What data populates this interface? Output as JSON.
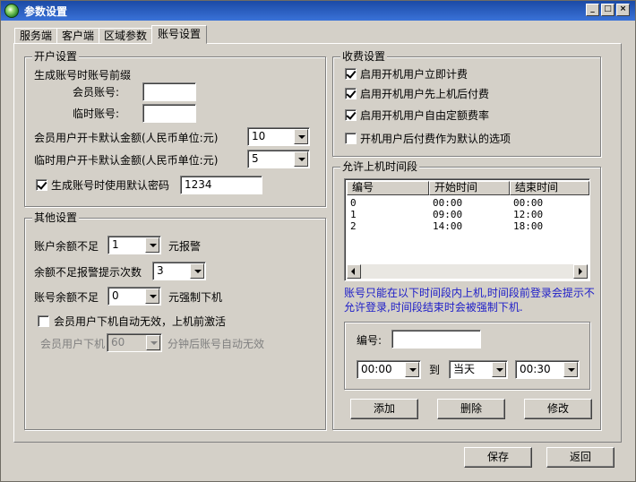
{
  "window": {
    "title": "参数设置",
    "min_glyph": "_",
    "max_glyph": "□",
    "close_glyph": "×"
  },
  "tabs": [
    {
      "label": "服务端"
    },
    {
      "label": "客户端"
    },
    {
      "label": "区域参数"
    },
    {
      "label": "账号设置"
    }
  ],
  "open_account": {
    "title": "开户设置",
    "prefix_heading": "生成账号时账号前缀",
    "member_account_label": "会员账号:",
    "member_account_value": "",
    "temp_account_label": "临时账号:",
    "temp_account_value": "",
    "member_default_amount_label": "会员用户开卡默认金额(人民币单位:元)",
    "member_default_amount_value": "10",
    "temp_default_amount_label": "临时用户开卡默认金额(人民币单位:元)",
    "temp_default_amount_value": "5",
    "default_password_label": "生成账号时使用默认密码",
    "default_password_checked": true,
    "default_password_value": "1234"
  },
  "other": {
    "title": "其他设置",
    "low_balance_label": "账户余额不足",
    "low_balance_value": "1",
    "low_balance_suffix": "元报警",
    "alert_count_label": "余额不足报警提示次数",
    "alert_count_value": "3",
    "force_offline_label": "账号余额不足",
    "force_offline_value": "0",
    "force_offline_suffix": "元强制下机",
    "auto_invalid_label": "会员用户下机自动无效，上机前激活",
    "auto_invalid_checked": false,
    "offline_label": "会员用户下机",
    "offline_value": "60",
    "offline_suffix": "分钟后账号自动无效"
  },
  "billing": {
    "title": "收费设置",
    "options": [
      {
        "label": "启用开机用户立即计费",
        "checked": true
      },
      {
        "label": "启用开机用户先上机后付费",
        "checked": true
      },
      {
        "label": "启用开机用户自由定额费率",
        "checked": true
      },
      {
        "label": "开机用户后付费作为默认的选项",
        "checked": false
      }
    ]
  },
  "time_slots": {
    "title": "允许上机时间段",
    "columns": [
      "编号",
      "开始时间",
      "结束时间"
    ],
    "rows": [
      [
        "0",
        "00:00",
        "00:00"
      ],
      [
        "1",
        "09:00",
        "12:00"
      ],
      [
        "2",
        "14:00",
        "18:00"
      ]
    ],
    "note": "账号只能在以下时间段内上机,时间段前登录会提示不允许登录,时间段结束时会被强制下机.",
    "id_label": "编号:",
    "id_value": "",
    "start_value": "00:00",
    "to_label": "到",
    "day_value": "当天",
    "end_value": "00:30",
    "add_label": "添加",
    "delete_label": "删除",
    "modify_label": "修改"
  },
  "footer": {
    "save_label": "保存",
    "back_label": "返回"
  },
  "colors": {
    "titlebar": "#1b4aa5",
    "face": "#d4d0c8",
    "note_text": "#1d1dc8"
  }
}
